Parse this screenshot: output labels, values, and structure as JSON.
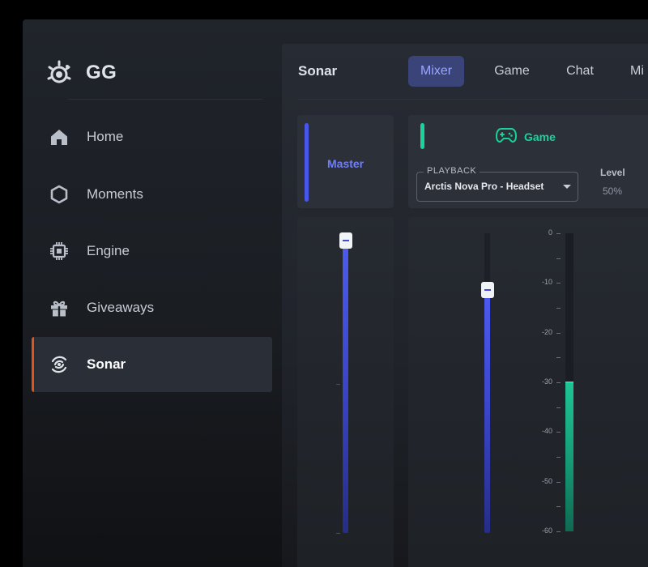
{
  "brand": {
    "name": "GG"
  },
  "sidebar": {
    "items": [
      {
        "key": "home",
        "label": "Home",
        "icon": "home-icon",
        "active": false
      },
      {
        "key": "moments",
        "label": "Moments",
        "icon": "hexagon-icon",
        "active": false
      },
      {
        "key": "engine",
        "label": "Engine",
        "icon": "chip-icon",
        "active": false
      },
      {
        "key": "giveaways",
        "label": "Giveaways",
        "icon": "gift-icon",
        "active": false
      },
      {
        "key": "sonar",
        "label": "Sonar",
        "icon": "sonar-icon",
        "active": true
      }
    ]
  },
  "main": {
    "title": "Sonar",
    "tabs": [
      {
        "label": "Mixer",
        "active": true
      },
      {
        "label": "Game",
        "active": false
      },
      {
        "label": "Chat",
        "active": false
      },
      {
        "label": "Mi",
        "active": false
      }
    ]
  },
  "master": {
    "label": "Master",
    "volume": 0.98
  },
  "game": {
    "label": "Game",
    "playback_label": "PLAYBACK",
    "device": "Arctis Nova Pro - Headset",
    "level_label": "Level",
    "level_value": "50%",
    "volume": 0.81,
    "meter": {
      "scale": [
        "0",
        "-10",
        "-20",
        "-30",
        "-40",
        "-50",
        "-60"
      ],
      "level_db": -30
    }
  },
  "colors": {
    "accent_orange": "#e2541a",
    "master_blue": "#4956ea",
    "game_green": "#19d39b",
    "active_tab_bg": "#3a4478"
  }
}
